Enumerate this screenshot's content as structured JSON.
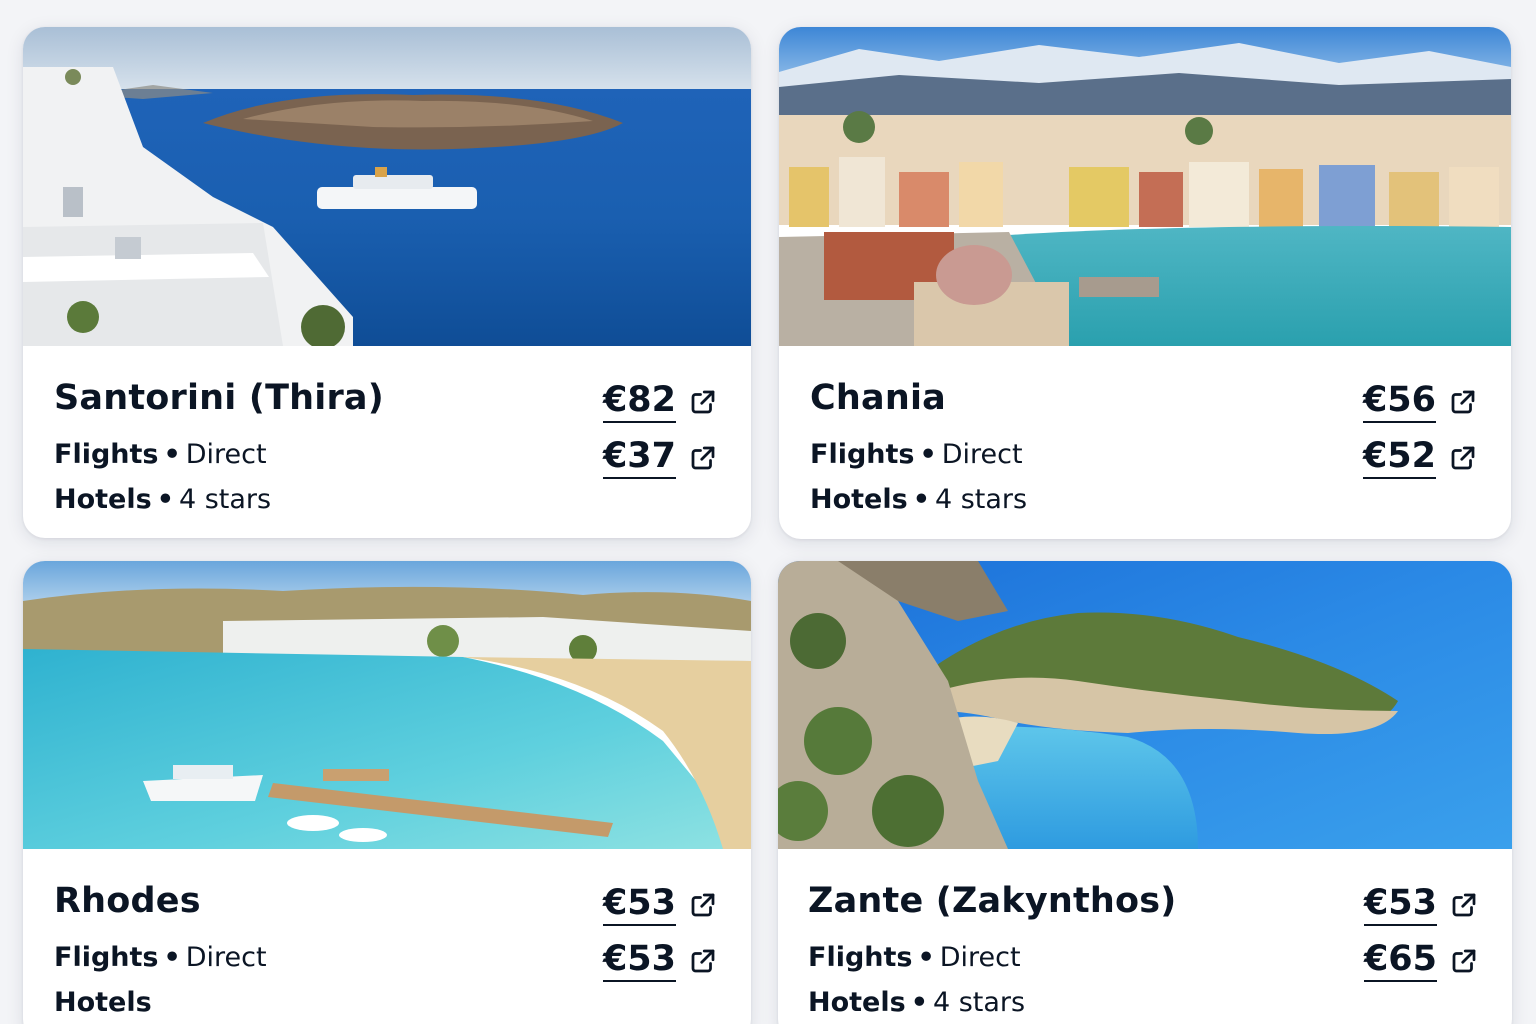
{
  "cards": [
    {
      "name": "Santorini (Thira)",
      "flights": {
        "label": "Flights",
        "detail": "Direct",
        "price": "€82"
      },
      "hotels": {
        "label": "Hotels",
        "detail": "4 stars",
        "price": "€37"
      }
    },
    {
      "name": "Chania",
      "flights": {
        "label": "Flights",
        "detail": "Direct",
        "price": "€56"
      },
      "hotels": {
        "label": "Hotels",
        "detail": "4 stars",
        "price": "€52"
      }
    },
    {
      "name": "Rhodes",
      "flights": {
        "label": "Flights",
        "detail": "Direct",
        "price": "€53"
      },
      "hotels": {
        "label": "Hotels",
        "detail": "",
        "price": "€53"
      }
    },
    {
      "name": "Zante (Zakynthos)",
      "flights": {
        "label": "Flights",
        "detail": "Direct",
        "price": "€53"
      },
      "hotels": {
        "label": "Hotels",
        "detail": "4 stars",
        "price": "€65"
      }
    }
  ],
  "separator": "•",
  "icons": {
    "price_link": "external-link-icon"
  }
}
